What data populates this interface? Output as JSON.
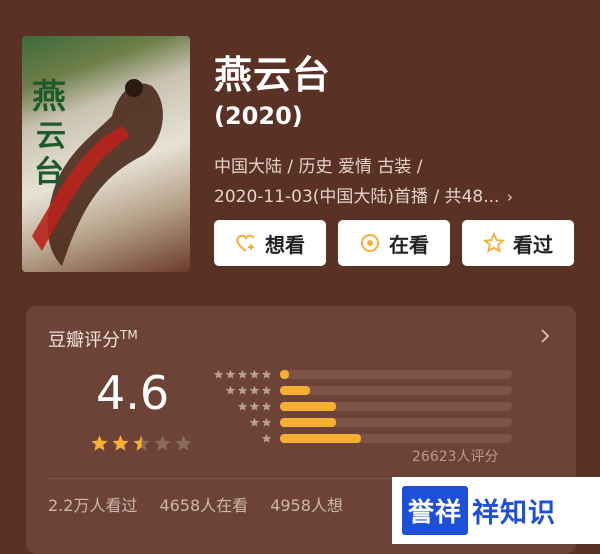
{
  "movie": {
    "title": "燕云台",
    "year": "(2020)",
    "meta_line1": "中国大陆 / 历史 爱情 古装 /",
    "meta_line2": "2020-11-03(中国大陆)首播 / 共48...",
    "poster_title": "燕云台"
  },
  "actions": [
    {
      "label": "想看",
      "icon": "heart-plus-icon"
    },
    {
      "label": "在看",
      "icon": "target-circle-icon"
    },
    {
      "label": "看过",
      "icon": "star-outline-icon"
    }
  ],
  "rating": {
    "header": "豆瓣评分",
    "header_sup": "TM",
    "score": "4.6",
    "stars_filled": 2.5,
    "count_text": "26623人评分",
    "distribution": [
      {
        "stars": 5,
        "fraction": 0.04
      },
      {
        "stars": 4,
        "fraction": 0.13
      },
      {
        "stars": 3,
        "fraction": 0.24
      },
      {
        "stars": 2,
        "fraction": 0.24
      },
      {
        "stars": 1,
        "fraction": 0.35
      }
    ],
    "stats": [
      "2.2万人看过",
      "4658人在看",
      "4958人想"
    ]
  },
  "watermark": {
    "logo": "誉祥",
    "text": "祥知识"
  },
  "colors": {
    "background": "#5a3225",
    "card": "#6c4336",
    "accent": "#f5b031"
  }
}
